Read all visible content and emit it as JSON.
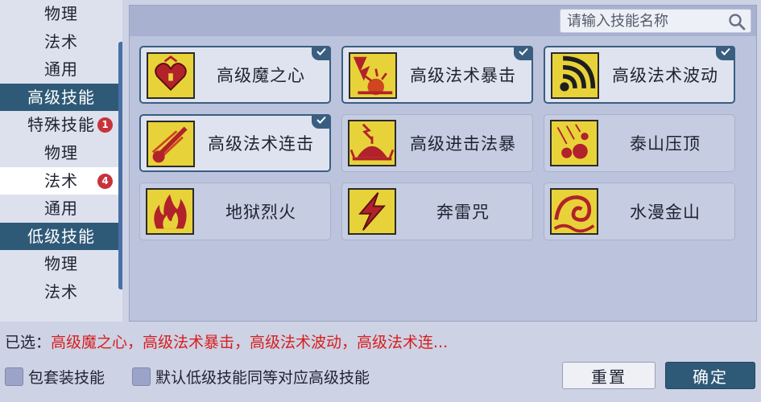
{
  "sidebar": {
    "items": [
      {
        "label": "物理"
      },
      {
        "label": "法术"
      },
      {
        "label": "通用"
      },
      {
        "label": "高级技能"
      },
      {
        "label": "特殊技能",
        "badge": "1"
      },
      {
        "label": "物理"
      },
      {
        "label": "法术",
        "badge": "4"
      },
      {
        "label": "通用"
      },
      {
        "label": "低级技能"
      },
      {
        "label": "物理"
      },
      {
        "label": "法术"
      }
    ]
  },
  "search": {
    "placeholder": "请输入技能名称"
  },
  "skills": [
    {
      "name": "高级魔之心",
      "icon": "heart-emblem-icon",
      "selected": true
    },
    {
      "name": "高级法术暴击",
      "icon": "burst-icon",
      "selected": true
    },
    {
      "name": "高级法术波动",
      "icon": "wave-icon",
      "selected": true
    },
    {
      "name": "高级法术连击",
      "icon": "comet-streak-icon",
      "selected": true
    },
    {
      "name": "高级进击法暴",
      "icon": "explosion-icon",
      "selected": false
    },
    {
      "name": "泰山压顶",
      "icon": "falling-rocks-icon",
      "selected": false
    },
    {
      "name": "地狱烈火",
      "icon": "flame-icon",
      "selected": false
    },
    {
      "name": "奔雷咒",
      "icon": "lightning-icon",
      "selected": false
    },
    {
      "name": "水漫金山",
      "icon": "water-swirl-icon",
      "selected": false
    }
  ],
  "selection": {
    "label": "已选：",
    "value": "高级魔之心，高级法术暴击，高级法术波动，高级法术连..."
  },
  "options": {
    "include_set_skills": "包套装技能",
    "default_low_as_high": "默认低级技能同等对应高级技能"
  },
  "buttons": {
    "reset": "重置",
    "confirm": "确定"
  },
  "colors": {
    "accent": "#2f5a77",
    "selected_text": "#d81e1e",
    "icon_bg": "#e8d23a"
  }
}
